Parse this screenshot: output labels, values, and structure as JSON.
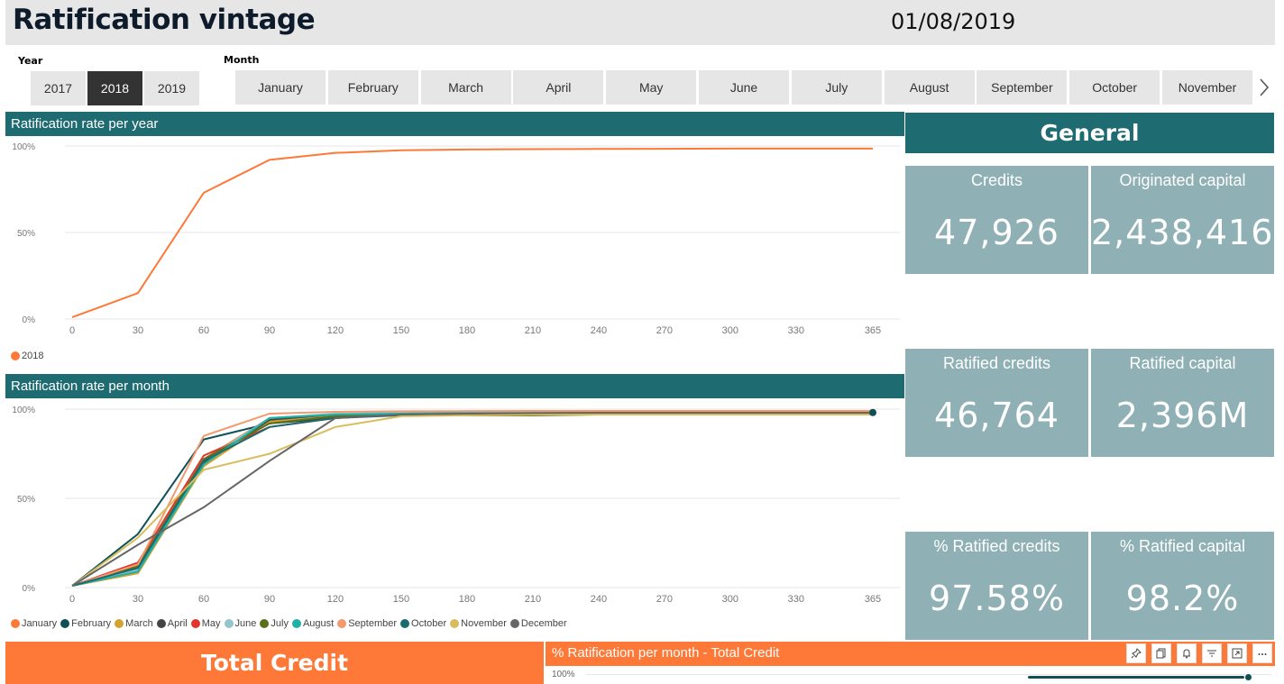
{
  "header": {
    "title": "Ratification vintage",
    "date": "01/08/2019"
  },
  "year_slicer": {
    "label": "Year",
    "options": [
      "2017",
      "2018",
      "2019"
    ],
    "selected": "2018"
  },
  "month_slicer": {
    "label": "Month",
    "options": [
      "January",
      "February",
      "March",
      "April",
      "May",
      "June",
      "July",
      "August",
      "September",
      "October",
      "November"
    ],
    "next_icon": "chevron-right-icon"
  },
  "year_chart": {
    "title": "Ratification rate per year"
  },
  "month_chart": {
    "title": "Ratification rate per month"
  },
  "general": {
    "title": "General",
    "cards": [
      {
        "label": "Credits",
        "value": "47,926"
      },
      {
        "label": "Originated capital",
        "value": "2,438,416..."
      },
      {
        "label": "Ratified credits",
        "value": "46,764"
      },
      {
        "label": "Ratified capital",
        "value": "2,396M"
      },
      {
        "label": "% Ratified credits",
        "value": "97.58%"
      },
      {
        "label": "% Ratified capital",
        "value": "98.2%"
      }
    ]
  },
  "bottom": {
    "total_credit_title": "Total Credit",
    "pm_title": "% Ratification per month - Total Credit",
    "pm_axis_label": "100%",
    "toolbar_icons": [
      "pin-icon",
      "copy-icon",
      "bell-icon",
      "filter-icon",
      "focus-mode-icon",
      "more-options-icon"
    ]
  },
  "colors": {
    "teal": "#1e6b71",
    "card": "#8fb1b5",
    "orange": "#fe7938",
    "selected": "#333333"
  },
  "chart_data": [
    {
      "type": "line",
      "title": "Ratification rate per year",
      "x": [
        0,
        30,
        60,
        90,
        120,
        150,
        180,
        210,
        240,
        270,
        300,
        330,
        365
      ],
      "x_ticks": [
        "0",
        "30",
        "60",
        "90",
        "120",
        "150",
        "180",
        "210",
        "240",
        "270",
        "300",
        "330",
        "365"
      ],
      "y_ticks": [
        "0%",
        "50%",
        "100%"
      ],
      "ylim": [
        0,
        100
      ],
      "grid": true,
      "legend_position": "bottom-left",
      "series": [
        {
          "name": "2018",
          "color": "#fe7938",
          "values": [
            1,
            15,
            73,
            92,
            96,
            97.5,
            98,
            98.2,
            98.3,
            98.4,
            98.5,
            98.5,
            98.5
          ]
        }
      ]
    },
    {
      "type": "line",
      "title": "Ratification rate per month",
      "x": [
        0,
        30,
        60,
        90,
        120,
        150,
        180,
        210,
        240,
        270,
        300,
        330,
        365
      ],
      "x_ticks": [
        "0",
        "30",
        "60",
        "90",
        "120",
        "150",
        "180",
        "210",
        "240",
        "270",
        "300",
        "330",
        "365"
      ],
      "y_ticks": [
        "0%",
        "50%",
        "100%"
      ],
      "ylim": [
        0,
        100
      ],
      "grid": true,
      "legend_position": "bottom",
      "series": [
        {
          "name": "January",
          "color": "#fe7938",
          "values": [
            1,
            12,
            72,
            95,
            97,
            98,
            98.3,
            98.5,
            98.6,
            98.7,
            98.8,
            98.8,
            98.8
          ]
        },
        {
          "name": "February",
          "color": "#0f4f56",
          "values": [
            1,
            30,
            83,
            92,
            95,
            97,
            97.5,
            97.8,
            98,
            98,
            98.1,
            98.1,
            98.1
          ]
        },
        {
          "name": "March",
          "color": "#d4a22f",
          "values": [
            1,
            8,
            68,
            93,
            96,
            97.5,
            98,
            98.2,
            98.3,
            98.4,
            98.5,
            98.5,
            98.5
          ]
        },
        {
          "name": "April",
          "color": "#444444",
          "values": [
            1,
            11,
            70,
            94,
            97,
            98,
            98.2,
            98.3,
            98.4,
            98.5,
            98.6,
            98.6,
            98.6
          ]
        },
        {
          "name": "May",
          "color": "#e0342c",
          "values": [
            1,
            14,
            74,
            90,
            95,
            97.5,
            98,
            98.3,
            98.4,
            98.5,
            98.6,
            98.6,
            98.6
          ]
        },
        {
          "name": "June",
          "color": "#93c5cc",
          "values": [
            1,
            10,
            71,
            95,
            97.5,
            98,
            98.3,
            98.4,
            98.5,
            98.5,
            98.5,
            98.5,
            98.5
          ]
        },
        {
          "name": "July",
          "color": "#5b6e19",
          "values": [
            1,
            12,
            72,
            92,
            96,
            96.5,
            96.5,
            96.5,
            97,
            97,
            97,
            97,
            97
          ]
        },
        {
          "name": "August",
          "color": "#1fb0a8",
          "values": [
            1,
            9,
            69,
            95,
            97,
            97.5,
            97.8,
            97.8,
            97.8,
            97.8,
            97.8,
            97.8,
            97.8
          ]
        },
        {
          "name": "September",
          "color": "#f29a6d",
          "values": [
            1,
            13,
            85,
            97.5,
            98.5,
            98.8,
            98.9,
            99,
            99,
            99,
            99,
            99,
            99
          ]
        },
        {
          "name": "October",
          "color": "#1a6b70",
          "values": [
            1,
            11,
            71,
            90,
            95,
            96.5,
            97,
            97.3,
            97.5,
            97.8,
            98,
            98,
            98
          ]
        },
        {
          "name": "November",
          "color": "#d9bc5c",
          "values": [
            1,
            28,
            66,
            75,
            90,
            96,
            96.5,
            97,
            97,
            97,
            97,
            97,
            97
          ]
        },
        {
          "name": "December",
          "color": "#666666",
          "values": [
            1,
            24,
            45,
            71,
            95,
            97,
            97.5,
            97.8,
            98,
            98,
            98,
            98,
            98
          ]
        }
      ]
    }
  ]
}
